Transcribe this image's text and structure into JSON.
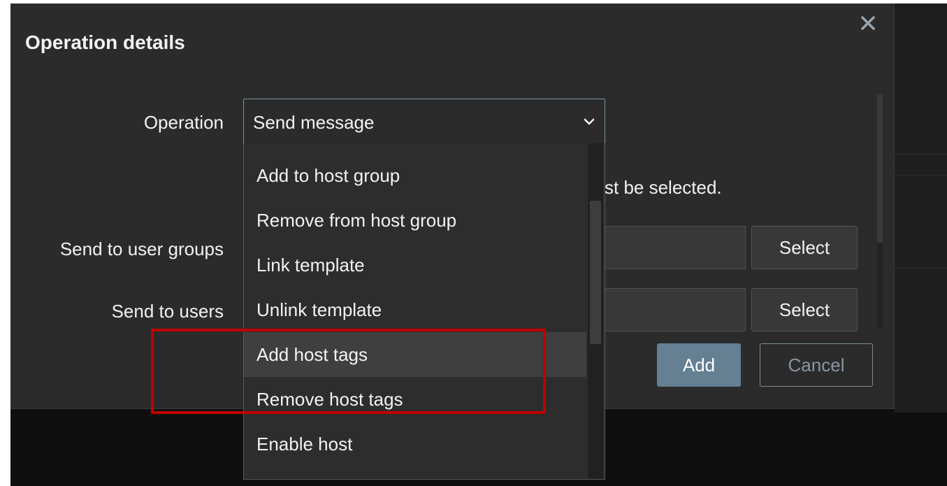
{
  "dialog": {
    "title": "Operation details",
    "close_icon": "close-icon"
  },
  "form": {
    "operation_label": "Operation",
    "operation_value": "Send message",
    "message_partial": "st be selected.",
    "user_groups_label": "Send to user groups",
    "users_label": "Send to users",
    "select_label": "Select",
    "add_label": "Add",
    "cancel_label": "Cancel"
  },
  "dropdown": {
    "items": [
      {
        "label": "Add to host group"
      },
      {
        "label": "Remove from host group"
      },
      {
        "label": "Link template"
      },
      {
        "label": "Unlink template"
      },
      {
        "label": "Add host tags",
        "hovered": true
      },
      {
        "label": "Remove host tags"
      },
      {
        "label": "Enable host"
      }
    ]
  },
  "annotation": {
    "highlight_color": "#c00000"
  },
  "colors": {
    "dialog_bg": "#2b2b2b",
    "primary_button": "#657f93",
    "combo_border": "#7b93a6"
  }
}
